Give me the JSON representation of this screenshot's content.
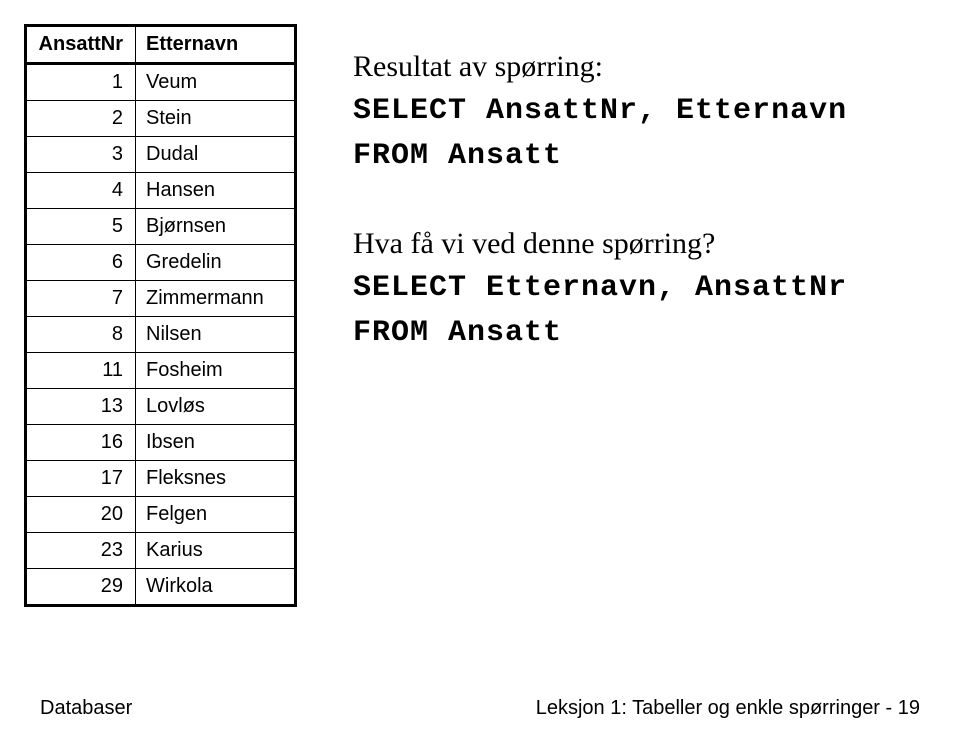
{
  "table": {
    "headers": {
      "nr": "AnsattNr",
      "name": "Etternavn"
    },
    "rows": [
      {
        "nr": "1",
        "name": "Veum"
      },
      {
        "nr": "2",
        "name": "Stein"
      },
      {
        "nr": "3",
        "name": "Dudal"
      },
      {
        "nr": "4",
        "name": "Hansen"
      },
      {
        "nr": "5",
        "name": "Bjørnsen"
      },
      {
        "nr": "6",
        "name": "Gredelin"
      },
      {
        "nr": "7",
        "name": "Zimmermann"
      },
      {
        "nr": "8",
        "name": "Nilsen"
      },
      {
        "nr": "11",
        "name": "Fosheim"
      },
      {
        "nr": "13",
        "name": "Lovløs"
      },
      {
        "nr": "16",
        "name": "Ibsen"
      },
      {
        "nr": "17",
        "name": "Fleksnes"
      },
      {
        "nr": "20",
        "name": "Felgen"
      },
      {
        "nr": "23",
        "name": "Karius"
      },
      {
        "nr": "29",
        "name": "Wirkola"
      }
    ]
  },
  "text": {
    "result_label": "Resultat av spørring:",
    "query1_line1": "SELECT AnsattNr, Etternavn",
    "query1_line2": "FROM Ansatt",
    "question2": "Hva få vi ved denne spørring?",
    "query2_line1": "SELECT Etternavn, AnsattNr",
    "query2_line2": "FROM Ansatt"
  },
  "footer": {
    "left": "Databaser",
    "right": "Leksjon 1: Tabeller og enkle spørringer - 19"
  }
}
